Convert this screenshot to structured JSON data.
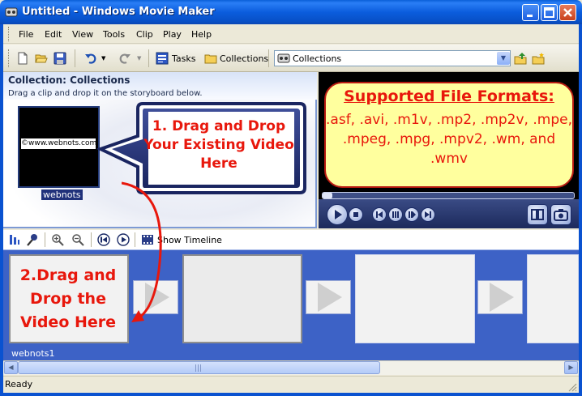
{
  "window": {
    "title": "Untitled - Windows Movie Maker"
  },
  "menu": {
    "items": [
      "File",
      "Edit",
      "View",
      "Tools",
      "Clip",
      "Play",
      "Help"
    ]
  },
  "toolbar": {
    "tasks_label": "Tasks",
    "collections_label": "Collections",
    "collections_select_value": "Collections"
  },
  "collection": {
    "title": "Collection: Collections",
    "hint": "Drag a clip and drop it on the storyboard below.",
    "clip_watermark": "©www.webnots.com",
    "clip_name": "webnots"
  },
  "callout": {
    "step1_text": "1. Drag and Drop Your Existing Video Here",
    "step2_text": "2.Drag and Drop the Video Here"
  },
  "formats": {
    "title": "Supported File Formats:",
    "list": ".asf, .avi, .m1v, .mp2, .mp2v, .mpe, .mpeg, .mpg, .mpv2, .wm, and .wmv"
  },
  "storyboard": {
    "show_timeline_label": "Show Timeline",
    "clip_label": "webnots1"
  },
  "status": {
    "text": "Ready"
  },
  "colors": {
    "titlebar": "#0b5ddd",
    "storyboard": "#3d62c6",
    "callout": "#e8170c",
    "formats_bg": "#ffff9e"
  }
}
